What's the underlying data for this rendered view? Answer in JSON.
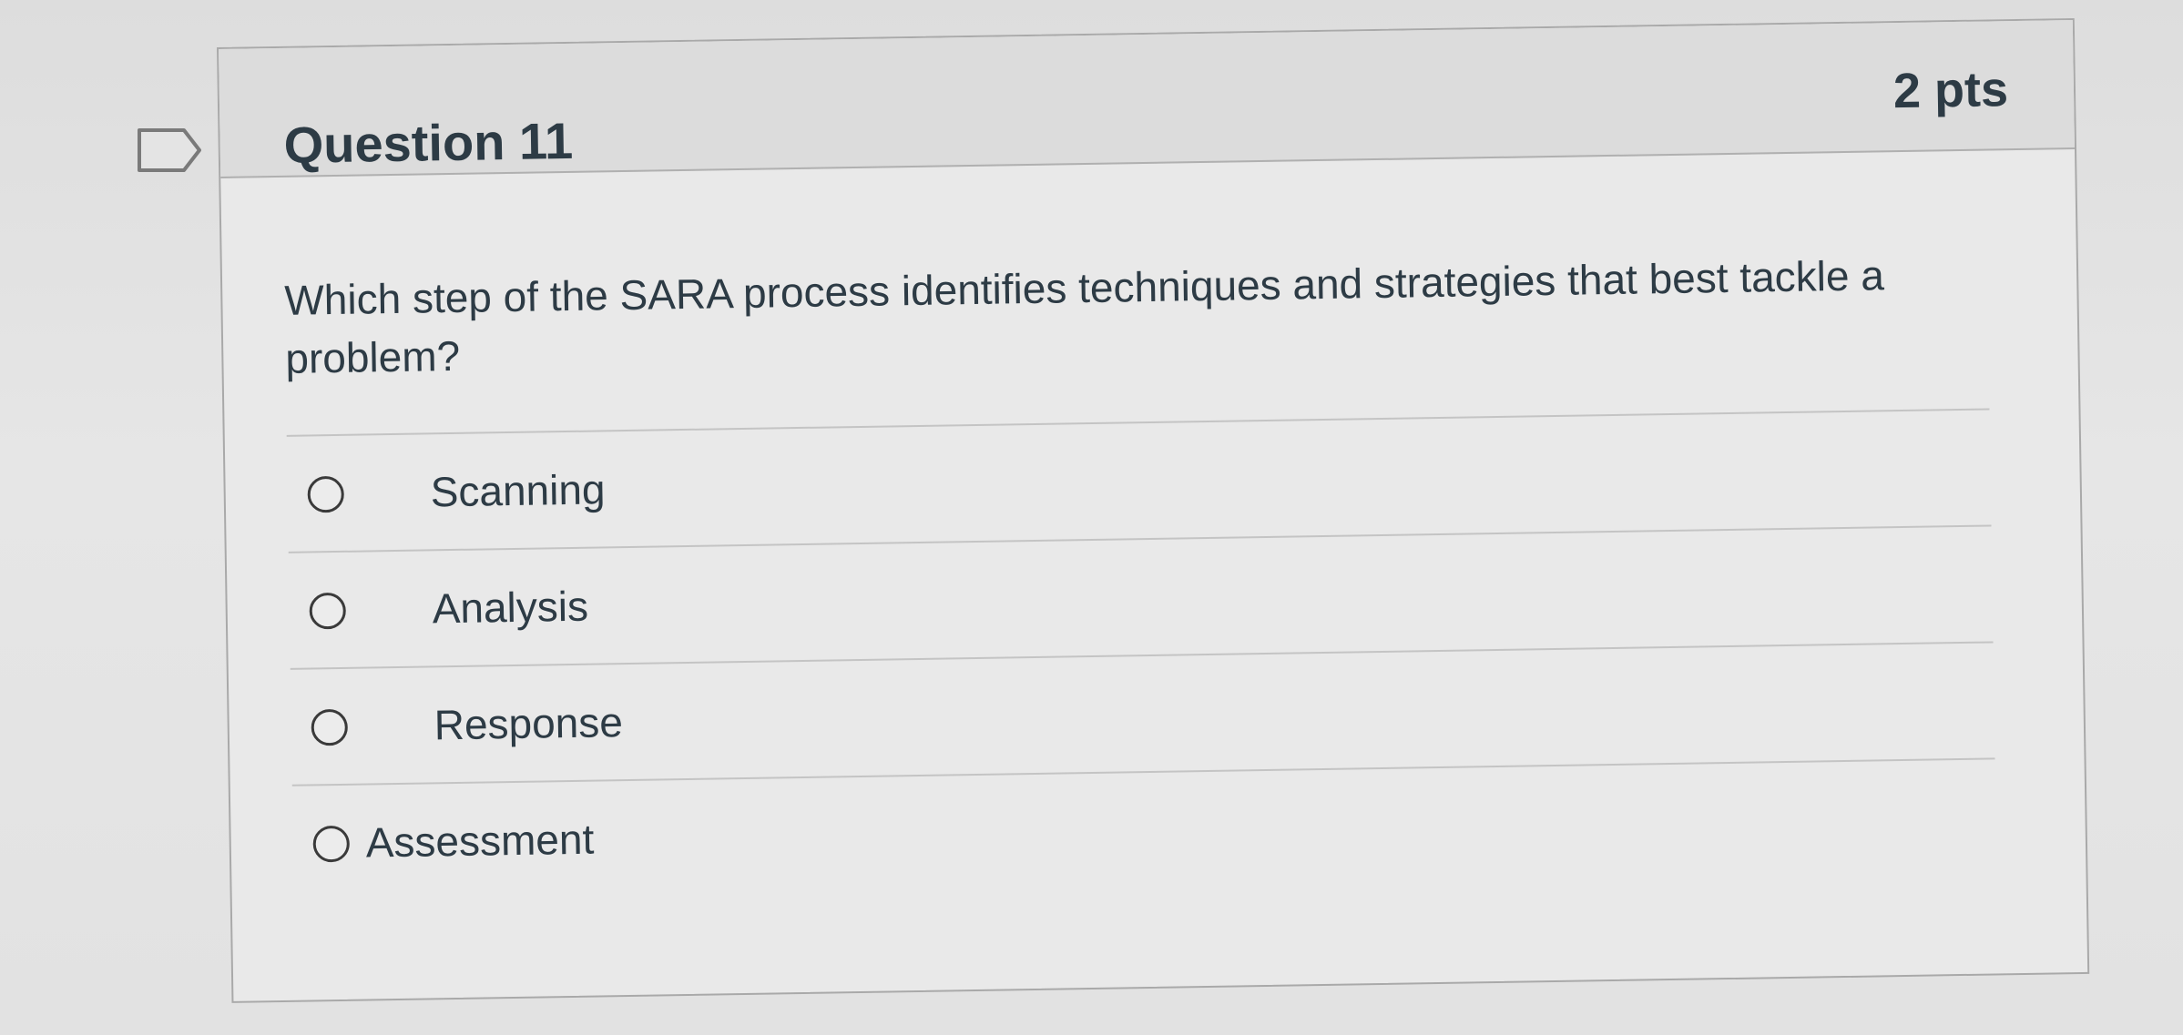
{
  "question": {
    "title": "Question 11",
    "points": "2 pts",
    "text": "Which step of the SARA process identifies techniques and strategies that best tackle a problem?"
  },
  "answers": [
    {
      "label": "Scanning",
      "selected": false
    },
    {
      "label": "Analysis",
      "selected": false
    },
    {
      "label": "Response",
      "selected": false
    },
    {
      "label": "Assessment",
      "selected": false
    }
  ],
  "icons": {
    "flag": "flag-question-icon",
    "radio": "radio-button-icon"
  },
  "colors": {
    "text": "#2d3b45",
    "header_bg": "#dcdcdc",
    "border": "#a9a9a9"
  }
}
